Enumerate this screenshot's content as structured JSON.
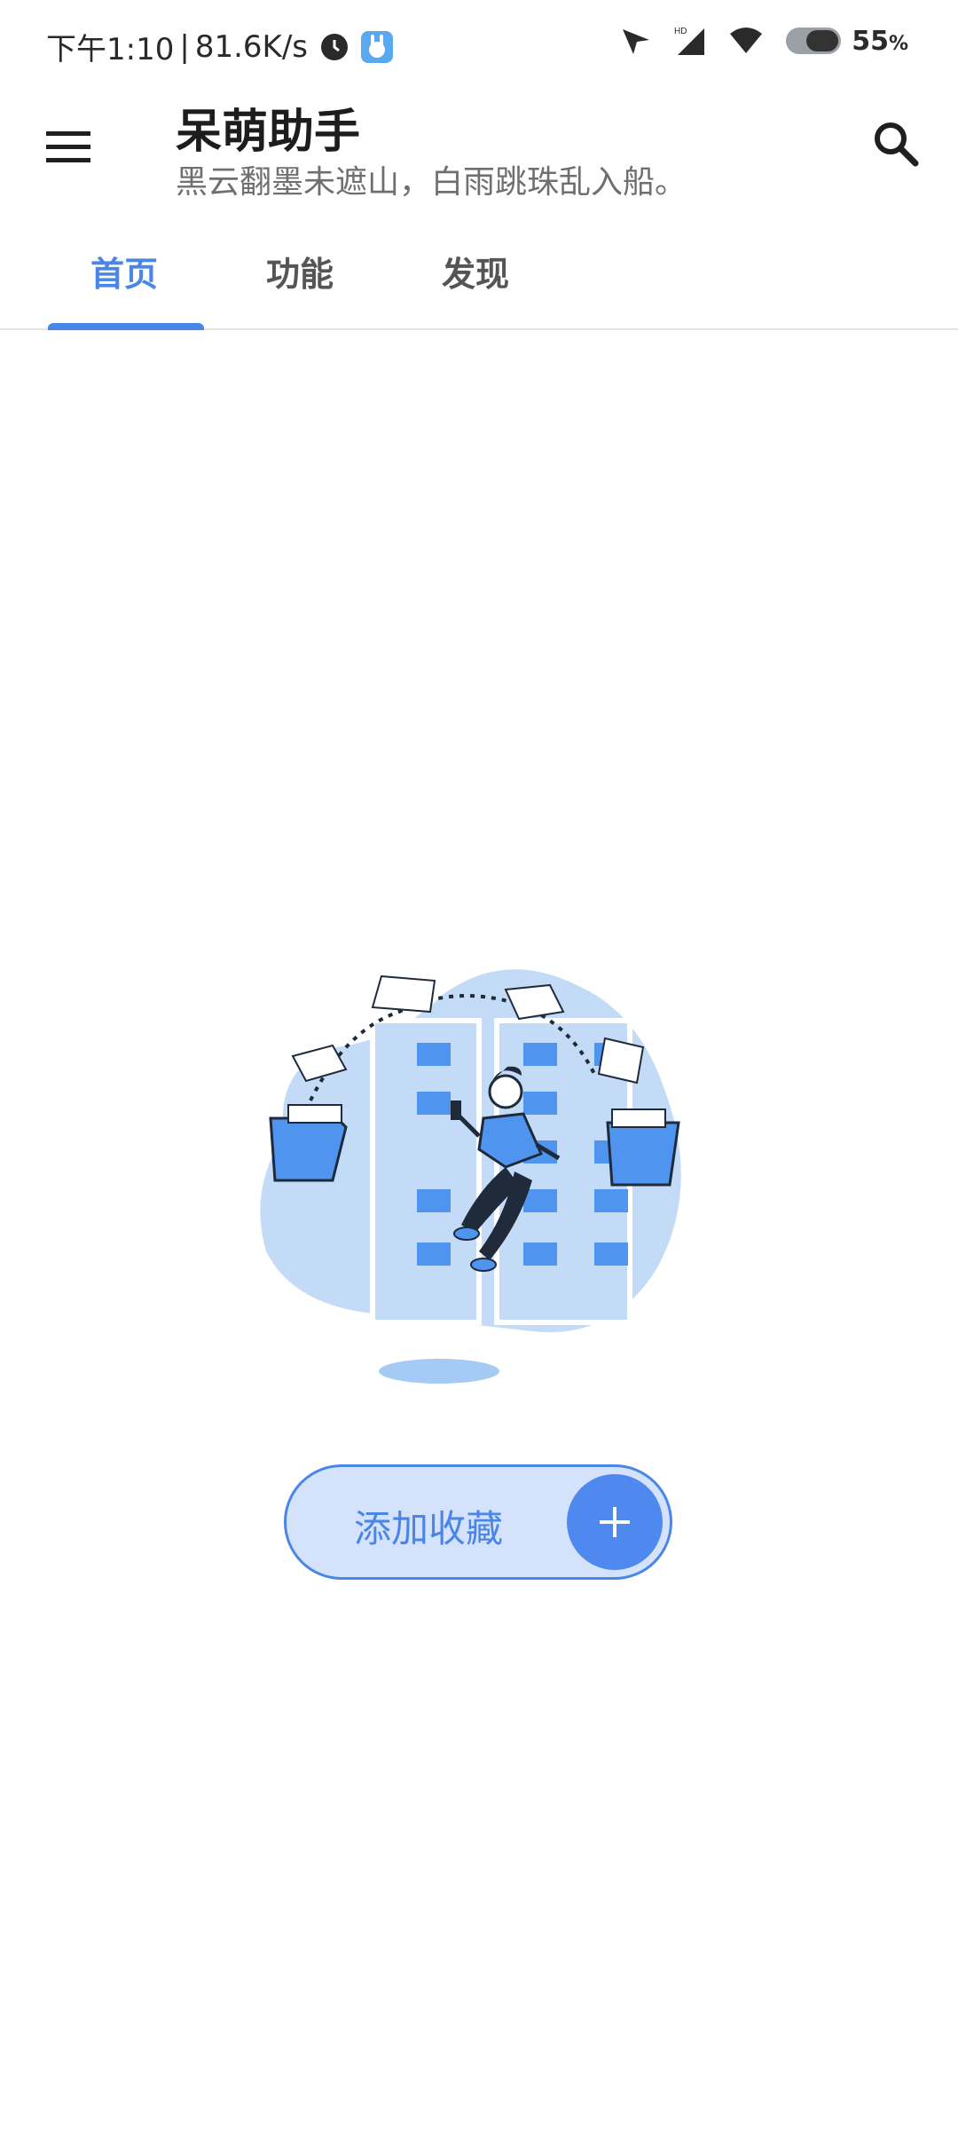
{
  "status_bar": {
    "time": "下午1:10",
    "separator": "|",
    "network_speed": "81.6K/s",
    "battery_percent": "55",
    "battery_unit": "%",
    "icons": [
      "clock-icon",
      "app-notification-icon",
      "location-arrow-icon",
      "hd-signal-icon",
      "wifi-icon",
      "battery-icon"
    ]
  },
  "app_bar": {
    "title": "呆萌助手",
    "subtitle": "黑云翻墨未遮山，白雨跳珠乱入船。",
    "icons": [
      "menu-icon",
      "search-icon"
    ]
  },
  "tabs": [
    {
      "label": "首页",
      "active": true
    },
    {
      "label": "功能",
      "active": false
    },
    {
      "label": "发现",
      "active": false
    }
  ],
  "empty_state": {
    "illustration": "person-with-folders-illustration",
    "button_label": "添加收藏",
    "button_icon": "plus-icon"
  },
  "colors": {
    "accent": "#4a86e8",
    "button_fill": "#d4e2fb",
    "illustration_light": "#c3dbf6",
    "illustration_blue": "#4f95f0"
  }
}
